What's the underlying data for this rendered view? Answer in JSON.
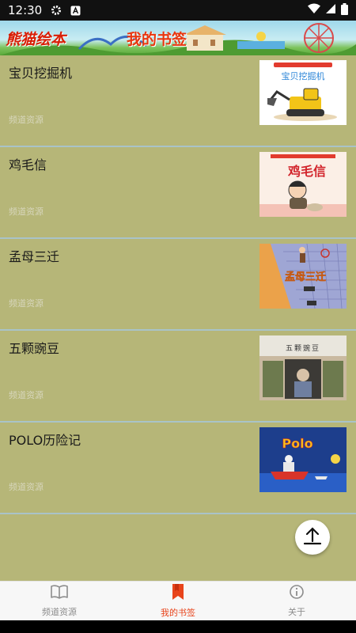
{
  "status_bar": {
    "time": "12:30"
  },
  "header": {
    "app_name": "熊猫绘本",
    "page_title": "我的书签"
  },
  "list": [
    {
      "title": "宝贝挖掘机",
      "subtitle": "频道资源",
      "cover_text": "宝贝挖掘机",
      "cover_icon": "excavator-cover"
    },
    {
      "title": "鸡毛信",
      "subtitle": "频道资源",
      "cover_text": "鸡毛信",
      "cover_icon": "boy-cover"
    },
    {
      "title": "孟母三迁",
      "subtitle": "频道资源",
      "cover_text": "孟母三迁",
      "cover_icon": "mother-cover"
    },
    {
      "title": "五颗豌豆",
      "subtitle": "频道资源",
      "cover_text": "五颗豌豆",
      "cover_icon": "window-cover"
    },
    {
      "title": "POLO历险记",
      "subtitle": "频道资源",
      "cover_text": "Polo",
      "cover_icon": "boat-cover"
    }
  ],
  "fab": {
    "icon": "scroll-to-top-icon"
  },
  "bottom_nav": [
    {
      "label": "频道资源",
      "icon": "book-icon",
      "active": false
    },
    {
      "label": "我的书签",
      "icon": "bookmark-icon",
      "active": true
    },
    {
      "label": "关于",
      "icon": "info-icon",
      "active": false
    }
  ],
  "colors": {
    "background": "#b6b678",
    "accent": "#e8441b",
    "divider": "#a9c3c8"
  }
}
